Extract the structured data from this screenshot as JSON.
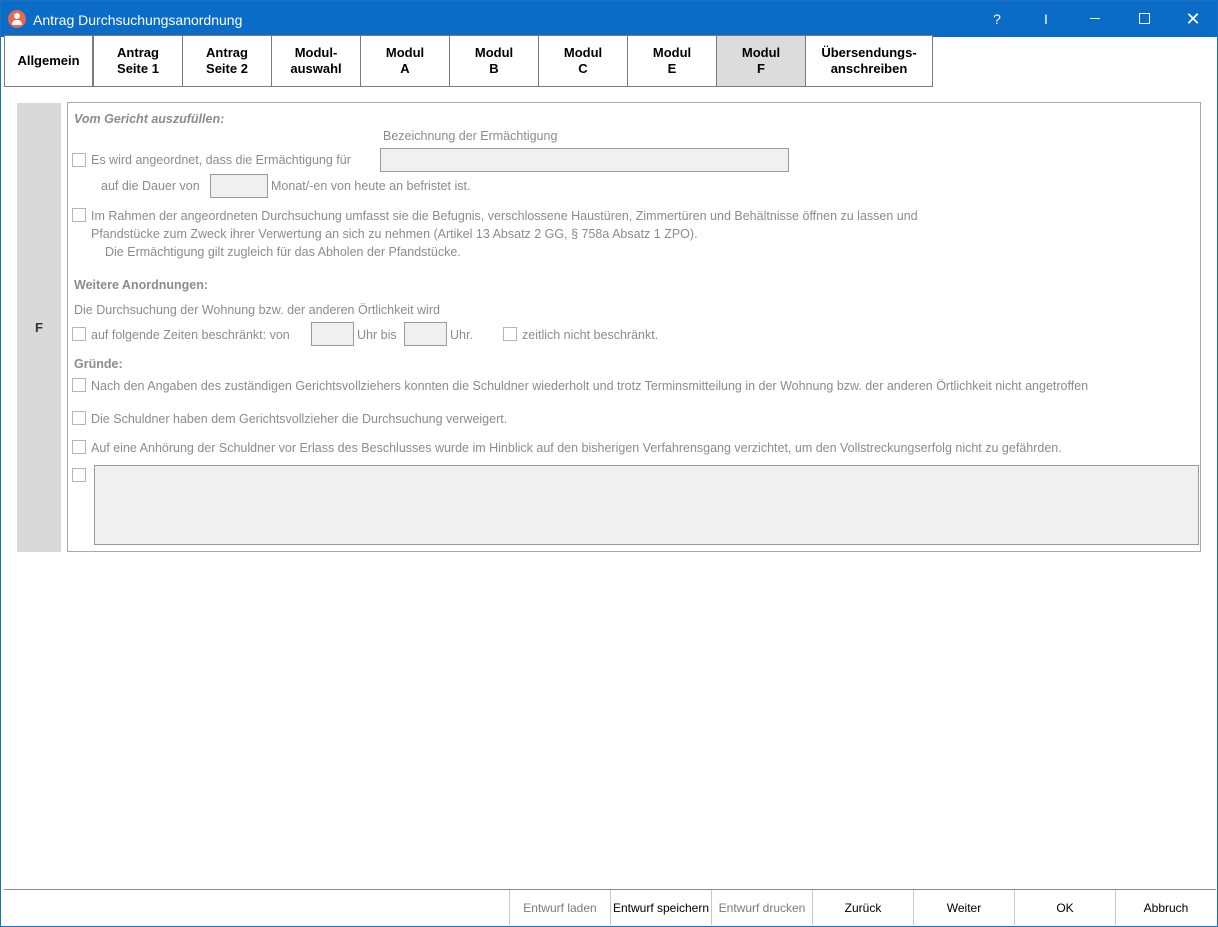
{
  "window": {
    "title": "Antrag Durchsuchungsanordnung",
    "help_glyph": "?",
    "cursor_glyph": "I",
    "close_glyph": "✕",
    "title_color": "#0a6cc7"
  },
  "tabs": [
    {
      "label": "Allgemein"
    },
    {
      "label": "Antrag\nSeite 1"
    },
    {
      "label": "Antrag\nSeite 2"
    },
    {
      "label": "Modul-\nauswahl"
    },
    {
      "label": "Modul\nA"
    },
    {
      "label": "Modul\nB"
    },
    {
      "label": "Modul\nC"
    },
    {
      "label": "Modul\nE"
    },
    {
      "label": "Modul\nF",
      "active": true
    },
    {
      "label": "Übersendungs-\nanschreiben"
    }
  ],
  "module": {
    "letter": "F",
    "section_court": "Vom Gericht auszufüllen:",
    "label_bezeichnung": "Bezeichnung der Ermächtigung",
    "opt_angeordnet": "Es wird angeordnet, dass die Ermächtigung für",
    "dauer_prefix": "auf die Dauer von",
    "dauer_suffix": "Monat/-en von heute an befristet ist.",
    "rahmen_line1": "Im Rahmen der angeordneten Durchsuchung umfasst sie die Befugnis, verschlossene Haustüren, Zimmertüren und Behältnisse öffnen zu lassen und",
    "rahmen_line2": "Pfandstücke zum Zweck ihrer Verwertung an sich zu nehmen (Artikel 13 Absatz 2 GG,  § 758a Absatz 1 ZPO).",
    "rahmen_line3": "Die Ermächtigung gilt zugleich für das Abholen der Pfandstücke.",
    "section_weitere": "Weitere Anordnungen:",
    "durchsuchung_text": "Die Durchsuchung der Wohnung bzw. der anderen Örtlichkeit wird",
    "zeiten_prefix": "auf folgende Zeiten beschränkt: von",
    "uhr_bis": "Uhr bis",
    "uhr": "Uhr.",
    "zeitlich": "zeitlich nicht beschränkt.",
    "section_gruende": "Gründe:",
    "grund1": "Nach den Angaben des zuständigen Gerichtsvollziehers konnten die Schuldner wiederholt und trotz Terminsmitteilung in der Wohnung bzw. der anderen Örtlichkeit nicht angetroffen",
    "grund2": "Die Schuldner haben dem Gerichtsvollzieher die Durchsuchung verweigert.",
    "grund3": "Auf eine Anhörung der Schuldner vor Erlass des Beschlusses wurde im Hinblick auf den bisherigen Verfahrensgang verzichtet, um den Vollstreckungserfolg nicht zu gefährden."
  },
  "buttons": {
    "entwurf_laden": "Entwurf laden",
    "entwurf_speichern": "Entwurf speichern",
    "entwurf_drucken": "Entwurf drucken",
    "zurueck": "Zurück",
    "weiter": "Weiter",
    "ok": "OK",
    "abbruch": "Abbruch"
  }
}
